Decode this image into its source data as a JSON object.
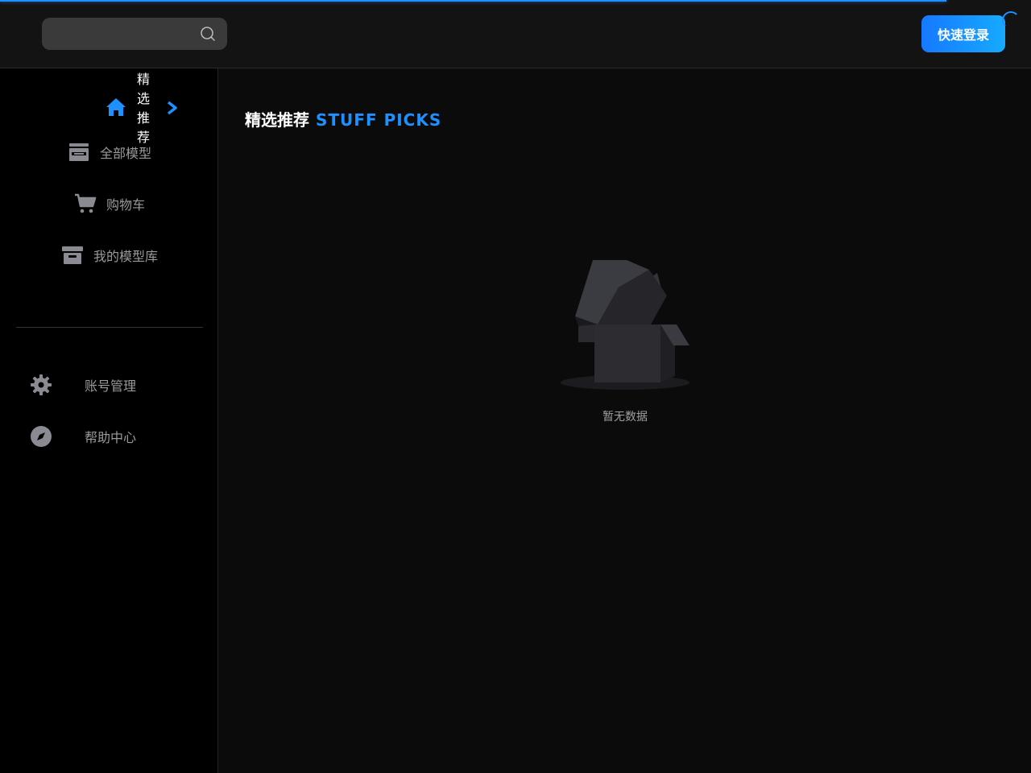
{
  "header": {
    "search": {
      "value": "",
      "placeholder": ""
    },
    "login_label": "快速登录"
  },
  "sidebar": {
    "active_item": {
      "label": "精选推荐",
      "icon": "home-icon"
    },
    "items": [
      {
        "label": "全部模型",
        "icon": "store-icon"
      },
      {
        "label": "购物车",
        "icon": "cart-icon"
      },
      {
        "label": "我的模型库",
        "icon": "archive-icon"
      }
    ],
    "bottom_items": [
      {
        "label": "账号管理",
        "icon": "gear-icon"
      },
      {
        "label": "帮助中心",
        "icon": "compass-icon"
      }
    ]
  },
  "main": {
    "title_cn": "精选推荐",
    "title_en": "STUFF PICKS",
    "empty_text": "暂无数据"
  },
  "colors": {
    "accent": "#1e90ff",
    "sidebar_bg": "#000000",
    "topbar_bg": "#141313",
    "main_bg": "#0b0b0b",
    "muted_text": "#9a9a9a",
    "icon_gray": "#8a8a93"
  },
  "loading_progress": 0.918
}
